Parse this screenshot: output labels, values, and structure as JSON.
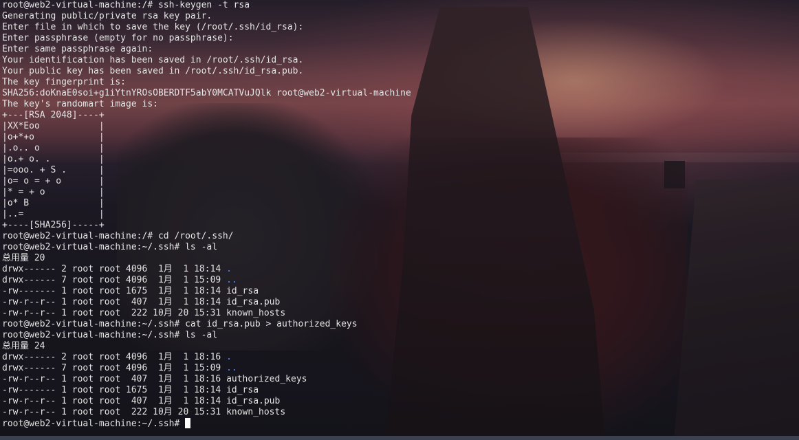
{
  "prompt": "root@web2-virtual-machine:~/.ssh#",
  "lines": [
    {
      "text": "root@web2-virtual-machine:/# ssh-keygen -t rsa"
    },
    {
      "text": "Generating public/private rsa key pair."
    },
    {
      "text": "Enter file in which to save the key (/root/.ssh/id_rsa):"
    },
    {
      "text": "Enter passphrase (empty for no passphrase):"
    },
    {
      "text": "Enter same passphrase again:"
    },
    {
      "text": "Your identification has been saved in /root/.ssh/id_rsa."
    },
    {
      "text": "Your public key has been saved in /root/.ssh/id_rsa.pub."
    },
    {
      "text": "The key fingerprint is:"
    },
    {
      "text": "SHA256:doKnaE0soi+g1iYtnYROsOBERDTF5abY0MCATVuJQlk root@web2-virtual-machine"
    },
    {
      "text": "The key's randomart image is:"
    },
    {
      "text": "+---[RSA 2048]----+"
    },
    {
      "text": "|XX*Eoo           |"
    },
    {
      "text": "|o+*+o            |"
    },
    {
      "text": "|.o.. o           |"
    },
    {
      "text": "|o.+ o. .         |"
    },
    {
      "text": "|=ooo. + S .      |"
    },
    {
      "text": "|o= o = + o       |"
    },
    {
      "text": "|* = + o          |"
    },
    {
      "text": "|o* B             |"
    },
    {
      "text": "|..=              |"
    },
    {
      "text": "+----[SHA256]-----+"
    },
    {
      "text": "root@web2-virtual-machine:/# cd /root/.ssh/"
    },
    {
      "text": "root@web2-virtual-machine:~/.ssh# ls -al"
    },
    {
      "text": "总用量 20"
    },
    {
      "text": "drwx------ 2 root root 4096  1月  1 18:14 ",
      "name": "."
    },
    {
      "text": "drwx------ 7 root root 4096  1月  1 15:09 ",
      "name": ".."
    },
    {
      "text": "-rw------- 1 root root 1675  1月  1 18:14 id_rsa"
    },
    {
      "text": "-rw-r--r-- 1 root root  407  1月  1 18:14 id_rsa.pub"
    },
    {
      "text": "-rw-r--r-- 1 root root  222 10月 20 15:31 known_hosts"
    },
    {
      "text": "root@web2-virtual-machine:~/.ssh# cat id_rsa.pub > authorized_keys"
    },
    {
      "text": "root@web2-virtual-machine:~/.ssh# ls -al"
    },
    {
      "text": "总用量 24"
    },
    {
      "text": "drwx------ 2 root root 4096  1月  1 18:16 ",
      "name": "."
    },
    {
      "text": "drwx------ 7 root root 4096  1月  1 15:09 ",
      "name": ".."
    },
    {
      "text": "-rw-r--r-- 1 root root  407  1月  1 18:16 authorized_keys"
    },
    {
      "text": "-rw------- 1 root root 1675  1月  1 18:14 id_rsa"
    },
    {
      "text": "-rw-r--r-- 1 root root  407  1月  1 18:14 id_rsa.pub"
    },
    {
      "text": "-rw-r--r-- 1 root root  222 10月 20 15:31 known_hosts"
    }
  ],
  "colors": {
    "text": "#e4e4e4",
    "directory": "#4e8cff",
    "cursor": "#ffffff"
  }
}
